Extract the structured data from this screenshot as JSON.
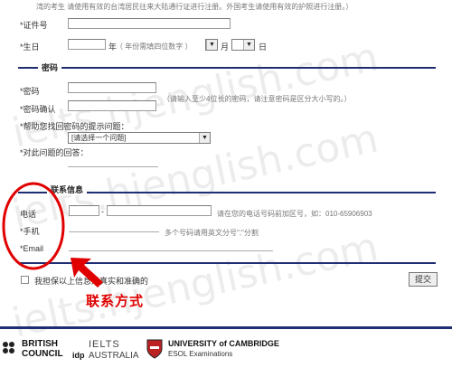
{
  "top_note": "湾的考生 请使用有效的台湾居民往来大陆通行证进行注册。外国考生请使用有效的护照进行注册。）",
  "personal": {
    "id_label": "*证件号",
    "birth_label": "*生日",
    "year_unit": "年",
    "year_hint": "（ 年份需填四位数字 ）",
    "month_unit": "月",
    "day_unit": "日"
  },
  "password_section": {
    "title": "密码",
    "password_label": "*密码",
    "password_hint": "（请输入至少4位长的密码，请注意密码是区分大小写的。）",
    "confirm_label": "*密码确认",
    "question_label": "*帮助您找回密码的提示问题：",
    "question_select": "[请选择一个问题]",
    "answer_label": "*对此问题的回答："
  },
  "contact_section": {
    "title": "联系信息",
    "phone_label": "电话",
    "phone_sep": "-",
    "phone_hint": "请在您的电话号码前加区号，如：010-65906903",
    "mobile_label": "*手机",
    "mobile_hint": "多个号码请用英文分号\";\"分割",
    "email_label": "*Email"
  },
  "confirm_text": "我担保以上信息是真实和准确的",
  "submit_label": "提交",
  "annotation_text": "联系方式",
  "watermark": "ielts.hjenglish.com",
  "logos": {
    "british_council": [
      "BRITISH",
      "COUNCIL"
    ],
    "idp": "idp",
    "ielts": "IELTS",
    "australia": "AUSTRALIA",
    "cambridge_line1": "UNIVERSITY of CAMBRIDGE",
    "cambridge_line2": "ESOL Examinations"
  },
  "colors": {
    "section_line": "#1f2d73",
    "annotation_red": "#e00000"
  }
}
